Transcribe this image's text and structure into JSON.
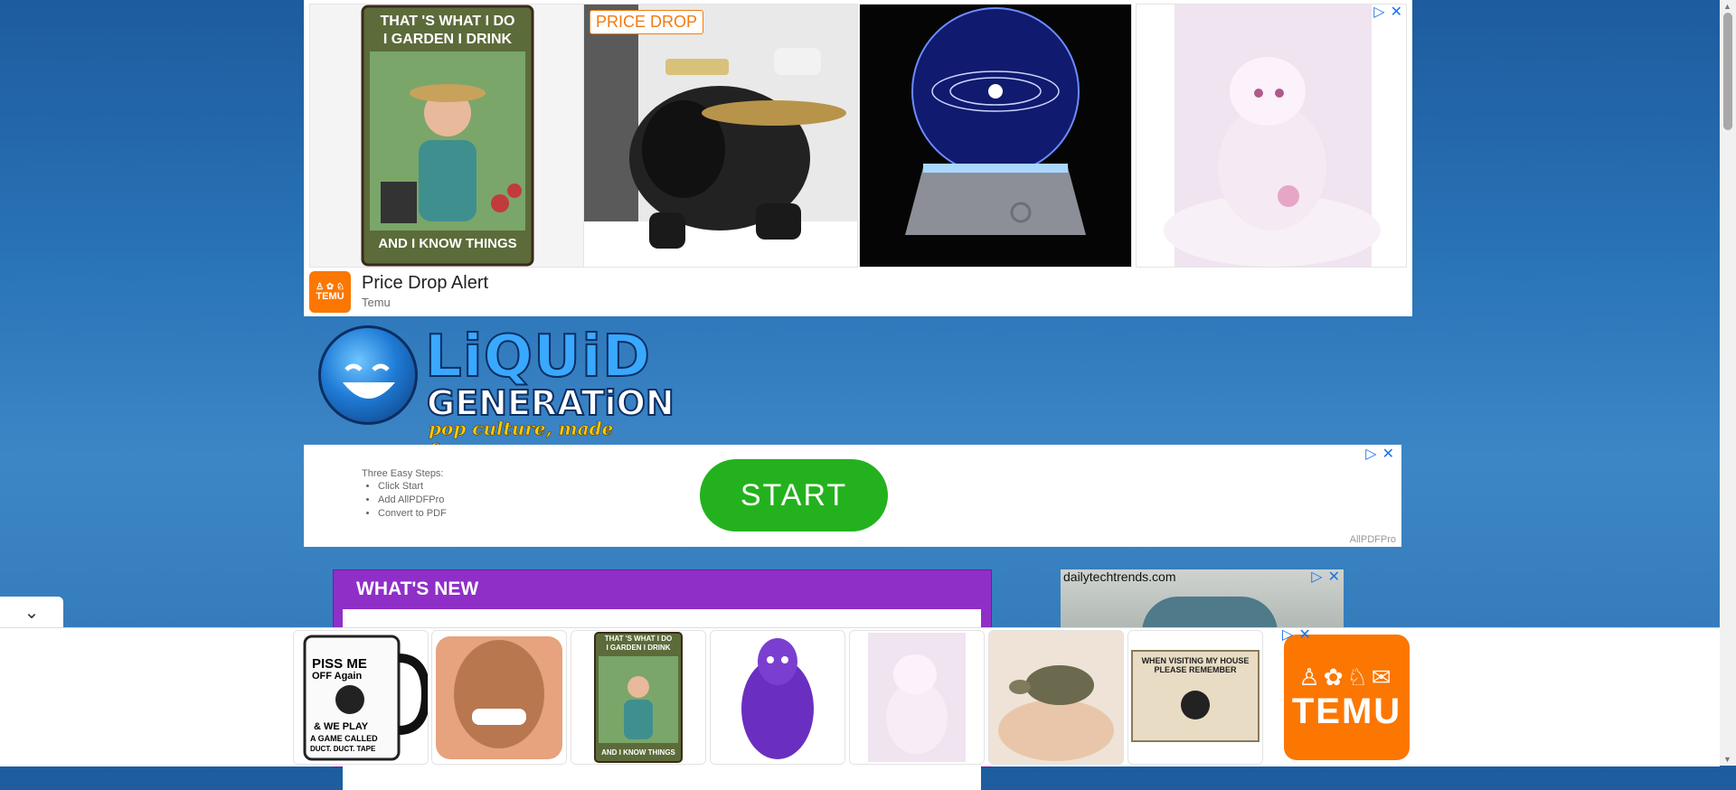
{
  "top_ad": {
    "badge": "PRICE DROP",
    "title": "Price Drop Alert",
    "advertiser": "Temu",
    "sign_top1": "THAT 'S WHAT I DO",
    "sign_top2": "I GARDEN I DRINK",
    "sign_bottom": "AND I KNOW THINGS",
    "temu_logo": "TEMU"
  },
  "logo": {
    "word1": "LiQUiD",
    "word2": "GENERATiON",
    "tagline": "pop culture, made funny."
  },
  "mid_ad": {
    "steps_title": "Three Easy Steps:",
    "steps": [
      "Click Start",
      "Add AllPDFPro",
      "Convert to PDF"
    ],
    "button": "START",
    "brand": "AllPDFPro"
  },
  "whats_new": {
    "title": "WHAT'S NEW"
  },
  "right_ad": {
    "domain": "dailytechtrends.com"
  },
  "bottom_ad": {
    "mug_text1": "PISS ME",
    "mug_text2": "OFF Again",
    "mug_text3": "& WE PLAY",
    "mug_text4": "A GAME CALLED",
    "mug_text5": "DUCT. DUCT. TAPE",
    "sign_top1": "THAT 'S WHAT I DO",
    "sign_top2": "I GARDEN I DRINK",
    "sign_bottom": "AND I KNOW THINGS",
    "house_sign": "WHEN VISITING MY HOUSE PLEASE REMEMBER",
    "temu_word": "TEMU"
  },
  "ad_controls": {
    "adchoices": "▷",
    "close": "✕"
  },
  "colors": {
    "temu_orange": "#fb7701",
    "start_green": "#23b21d",
    "purple": "#8f2fc7"
  }
}
